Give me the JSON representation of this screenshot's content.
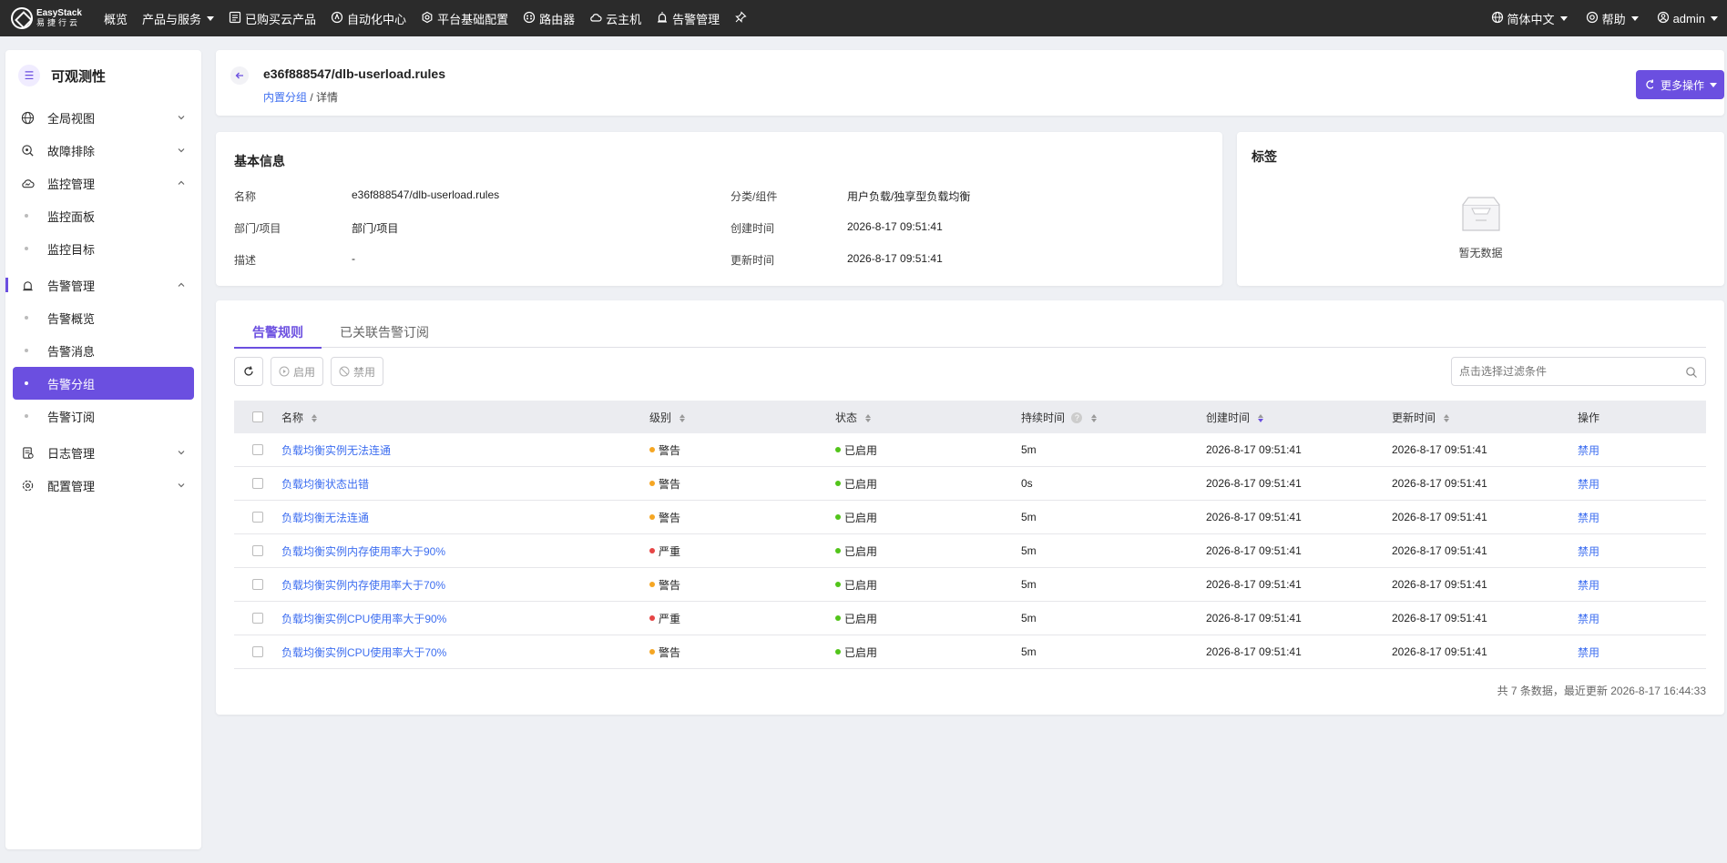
{
  "colors": {
    "accent": "#6b4fe0",
    "link": "#3d6ef0",
    "warning": "#f5a623",
    "critical": "#e64545",
    "enabled": "#52c41a"
  },
  "topbar": {
    "logo_line1": "EasyStack",
    "logo_line2": "易捷行云",
    "nav": [
      {
        "label": "概览",
        "icon": ""
      },
      {
        "label": "产品与服务",
        "icon": "caret-down"
      },
      {
        "label": "已购买云产品",
        "icon": "list-icon"
      },
      {
        "label": "自动化中心",
        "icon": "automation-icon"
      },
      {
        "label": "平台基础配置",
        "icon": "gear-icon"
      },
      {
        "label": "路由器",
        "icon": "router-icon"
      },
      {
        "label": "云主机",
        "icon": "cloud-icon"
      },
      {
        "label": "告警管理",
        "icon": "alarm-icon"
      },
      {
        "label": "",
        "icon": "pin-icon"
      }
    ],
    "language": "简体中文",
    "help": "帮助",
    "user": "admin"
  },
  "sidebar": {
    "title": "可观测性",
    "items": [
      {
        "label": "全局视图",
        "icon": "globe-icon",
        "expanded": false
      },
      {
        "label": "故障排除",
        "icon": "troubleshoot-icon",
        "expanded": false
      },
      {
        "label": "监控管理",
        "icon": "monitor-icon",
        "expanded": true,
        "children": [
          "监控面板",
          "监控目标"
        ]
      },
      {
        "label": "告警管理",
        "icon": "alarm-icon",
        "expanded": true,
        "children": [
          "告警概览",
          "告警消息",
          "告警分组",
          "告警订阅"
        ]
      },
      {
        "label": "日志管理",
        "icon": "log-icon",
        "expanded": false
      },
      {
        "label": "配置管理",
        "icon": "settings-icon",
        "expanded": false
      }
    ],
    "active_child": "告警分组"
  },
  "header": {
    "title": "e36f888547/dlb-userload.rules",
    "breadcrumb_link": "内置分组",
    "breadcrumb_sep": "/",
    "breadcrumb_current": "详情",
    "more_actions": "更多操作"
  },
  "info": {
    "title": "基本信息",
    "name_label": "名称",
    "name_value": "e36f888547/dlb-userload.rules",
    "dept_label": "部门/项目",
    "dept_value": "部门/项目",
    "desc_label": "描述",
    "desc_value": "-",
    "category_label": "分类/组件",
    "category_value": "用户负载/独享型负载均衡",
    "created_label": "创建时间",
    "created_value": "2026-8-17 09:51:41",
    "updated_label": "更新时间",
    "updated_value": "2026-8-17 09:51:41"
  },
  "tags": {
    "title": "标签",
    "empty": "暂无数据"
  },
  "tabs": [
    "告警规则",
    "已关联告警订阅"
  ],
  "toolbar": {
    "enable": "启用",
    "disable": "禁用",
    "search_placeholder": "点击选择过滤条件"
  },
  "table": {
    "headers": {
      "name": "名称",
      "level": "级别",
      "status": "状态",
      "duration": "持续时间",
      "created": "创建时间",
      "updated": "更新时间",
      "op": "操作"
    },
    "rows": [
      {
        "name": "负载均衡实例无法连通",
        "level": "警告",
        "level_type": "warning",
        "status": "已启用",
        "duration": "5m",
        "created": "2026-8-17 09:51:41",
        "updated": "2026-8-17 09:51:41",
        "op": "禁用"
      },
      {
        "name": "负载均衡状态出错",
        "level": "警告",
        "level_type": "warning",
        "status": "已启用",
        "duration": "0s",
        "created": "2026-8-17 09:51:41",
        "updated": "2026-8-17 09:51:41",
        "op": "禁用"
      },
      {
        "name": "负载均衡无法连通",
        "level": "警告",
        "level_type": "warning",
        "status": "已启用",
        "duration": "5m",
        "created": "2026-8-17 09:51:41",
        "updated": "2026-8-17 09:51:41",
        "op": "禁用"
      },
      {
        "name": "负载均衡实例内存使用率大于90%",
        "level": "严重",
        "level_type": "critical",
        "status": "已启用",
        "duration": "5m",
        "created": "2026-8-17 09:51:41",
        "updated": "2026-8-17 09:51:41",
        "op": "禁用"
      },
      {
        "name": "负载均衡实例内存使用率大于70%",
        "level": "警告",
        "level_type": "warning",
        "status": "已启用",
        "duration": "5m",
        "created": "2026-8-17 09:51:41",
        "updated": "2026-8-17 09:51:41",
        "op": "禁用"
      },
      {
        "name": "负载均衡实例CPU使用率大于90%",
        "level": "严重",
        "level_type": "critical",
        "status": "已启用",
        "duration": "5m",
        "created": "2026-8-17 09:51:41",
        "updated": "2026-8-17 09:51:41",
        "op": "禁用"
      },
      {
        "name": "负载均衡实例CPU使用率大于70%",
        "level": "警告",
        "level_type": "warning",
        "status": "已启用",
        "duration": "5m",
        "created": "2026-8-17 09:51:41",
        "updated": "2026-8-17 09:51:41",
        "op": "禁用"
      }
    ],
    "footer": "共 7 条数据，最近更新   2026-8-17 16:44:33"
  }
}
